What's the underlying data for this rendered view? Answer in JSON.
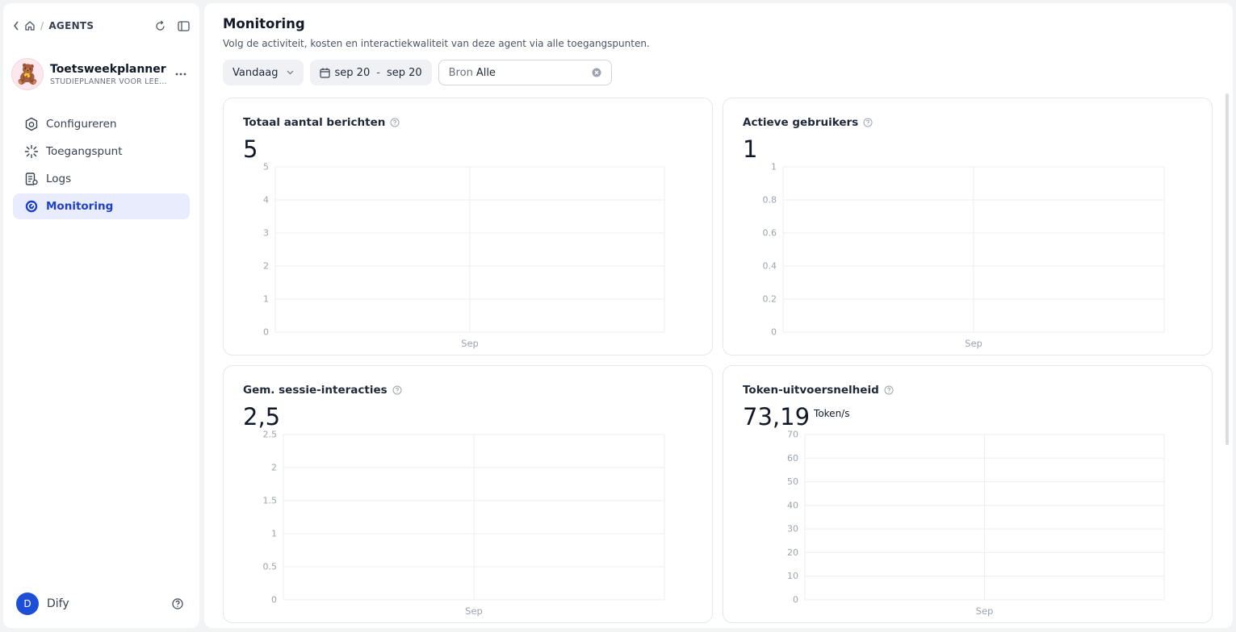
{
  "sidebar": {
    "breadcrumb_label": "AGENTS",
    "app": {
      "avatar": "🧸",
      "name": "Toetsweekplanner",
      "subtitle": "STUDIEPLANNER VOOR LEE..."
    },
    "nav": [
      {
        "label": "Configureren",
        "icon": "settings-icon"
      },
      {
        "label": "Toegangspunt",
        "icon": "access-point-icon"
      },
      {
        "label": "Logs",
        "icon": "logs-icon"
      },
      {
        "label": "Monitoring",
        "icon": "monitoring-icon",
        "active": true
      }
    ],
    "user": {
      "initial": "D",
      "name": "Dify"
    }
  },
  "header": {
    "title": "Monitoring",
    "subtitle": "Volg de activiteit, kosten en interactiekwaliteit van deze agent via alle toegangspunten."
  },
  "filters": {
    "period": "Vandaag",
    "date_from": "sep 20",
    "date_to": "sep 20",
    "source_label": "Bron",
    "source_value": "Alle"
  },
  "colors": {
    "accent": "#1e40c8",
    "accent_bg": "#e8ecfd",
    "grid": "#eceef1"
  },
  "chart_data": [
    {
      "type": "line",
      "title": "Totaal aantal berichten",
      "value": "5",
      "categories": [
        "Sep"
      ],
      "yticks": [
        "0",
        "1",
        "2",
        "3",
        "4",
        "5"
      ],
      "ylim": [
        0,
        5
      ],
      "grid": true
    },
    {
      "type": "line",
      "title": "Actieve gebruikers",
      "value": "1",
      "categories": [
        "Sep"
      ],
      "yticks": [
        "0",
        "0.2",
        "0.4",
        "0.6",
        "0.8",
        "1"
      ],
      "ylim": [
        0,
        1
      ],
      "grid": true
    },
    {
      "type": "line",
      "title": "Gem. sessie-interacties",
      "value": "2,5",
      "categories": [
        "Sep"
      ],
      "yticks": [
        "0",
        "0.5",
        "1",
        "1.5",
        "2",
        "2.5"
      ],
      "ylim": [
        0,
        2.5
      ],
      "grid": true
    },
    {
      "type": "line",
      "title": "Token-uitvoersnelheid",
      "value": "73,19",
      "unit": "Token/s",
      "categories": [
        "Sep"
      ],
      "yticks": [
        "0",
        "10",
        "20",
        "30",
        "40",
        "50",
        "60",
        "70"
      ],
      "ylim": [
        0,
        70
      ],
      "grid": true
    }
  ]
}
